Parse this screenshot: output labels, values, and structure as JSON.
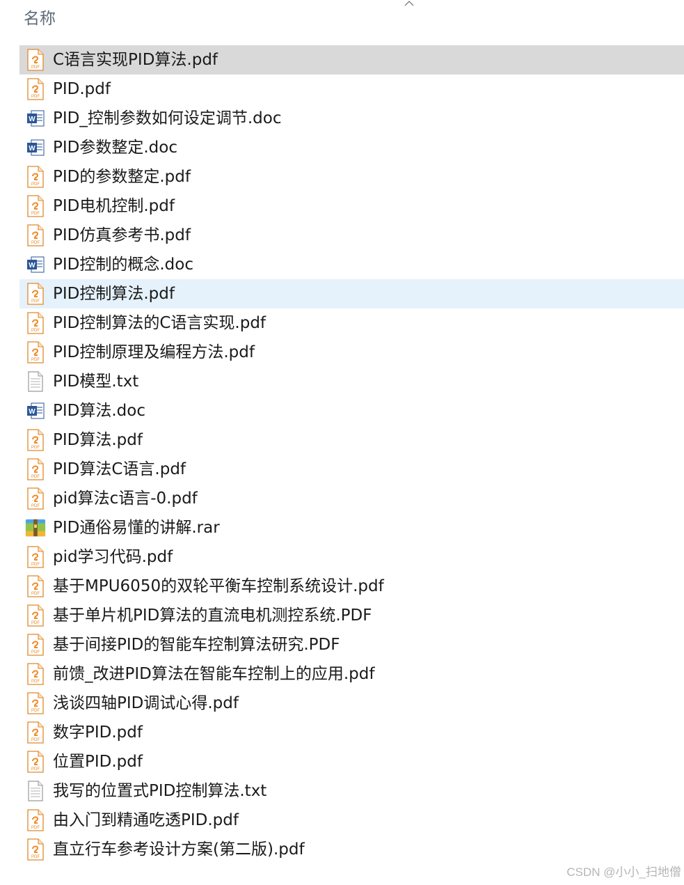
{
  "header": {
    "name_column": "名称",
    "sort_icon": "chevron-up-icon"
  },
  "files": [
    {
      "name": "C语言实现PID算法.pdf",
      "type": "pdf",
      "state": "selected"
    },
    {
      "name": "PID.pdf",
      "type": "pdf",
      "state": ""
    },
    {
      "name": "PID_控制参数如何设定调节.doc",
      "type": "doc",
      "state": ""
    },
    {
      "name": "PID参数整定.doc",
      "type": "doc",
      "state": ""
    },
    {
      "name": "PID的参数整定.pdf",
      "type": "pdf",
      "state": ""
    },
    {
      "name": "PID电机控制.pdf",
      "type": "pdf",
      "state": ""
    },
    {
      "name": "PID仿真参考书.pdf",
      "type": "pdf",
      "state": ""
    },
    {
      "name": "PID控制的概念.doc",
      "type": "doc",
      "state": ""
    },
    {
      "name": "PID控制算法.pdf",
      "type": "pdf",
      "state": "hover"
    },
    {
      "name": "PID控制算法的C语言实现.pdf",
      "type": "pdf",
      "state": ""
    },
    {
      "name": "PID控制原理及编程方法.pdf",
      "type": "pdf",
      "state": ""
    },
    {
      "name": "PID模型.txt",
      "type": "txt",
      "state": ""
    },
    {
      "name": "PID算法.doc",
      "type": "doc",
      "state": ""
    },
    {
      "name": "PID算法.pdf",
      "type": "pdf",
      "state": ""
    },
    {
      "name": "PID算法C语言.pdf",
      "type": "pdf",
      "state": ""
    },
    {
      "name": "pid算法c语言-0.pdf",
      "type": "pdf",
      "state": ""
    },
    {
      "name": "PID通俗易懂的讲解.rar",
      "type": "rar",
      "state": ""
    },
    {
      "name": "pid学习代码.pdf",
      "type": "pdf",
      "state": ""
    },
    {
      "name": "基于MPU6050的双轮平衡车控制系统设计.pdf",
      "type": "pdf",
      "state": ""
    },
    {
      "name": "基于单片机PID算法的直流电机测控系统.PDF",
      "type": "pdf",
      "state": ""
    },
    {
      "name": "基于间接PID的智能车控制算法研究.PDF",
      "type": "pdf",
      "state": ""
    },
    {
      "name": "前馈_改进PID算法在智能车控制上的应用.pdf",
      "type": "pdf",
      "state": ""
    },
    {
      "name": "浅谈四轴PID调试心得.pdf",
      "type": "pdf",
      "state": ""
    },
    {
      "name": "数字PID.pdf",
      "type": "pdf",
      "state": ""
    },
    {
      "name": "位置PID.pdf",
      "type": "pdf",
      "state": ""
    },
    {
      "name": "我写的位置式PID控制算法.txt",
      "type": "txt",
      "state": ""
    },
    {
      "name": "由入门到精通吃透PID.pdf",
      "type": "pdf",
      "state": ""
    },
    {
      "name": "直立行车参考设计方案(第二版).pdf",
      "type": "pdf",
      "state": ""
    }
  ],
  "icons": {
    "pdf": "pdf-file-icon",
    "doc": "word-document-icon",
    "txt": "text-file-icon",
    "rar": "archive-file-icon"
  },
  "colors": {
    "selected_row": "#d9d9d9",
    "hover_row": "#e5f1fb",
    "pdf_accent": "#f08a24",
    "doc_accent": "#2b5797"
  },
  "watermark": "CSDN @小小_扫地僧"
}
